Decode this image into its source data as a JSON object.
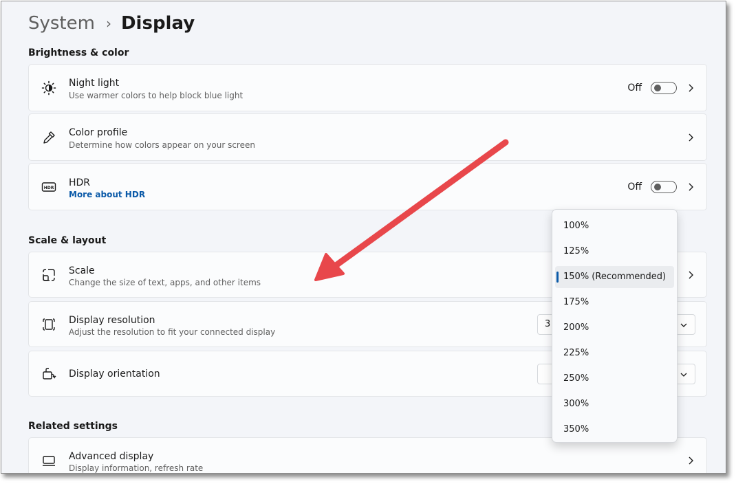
{
  "breadcrumb": {
    "parent": "System",
    "separator": "›",
    "current": "Display"
  },
  "sections": {
    "brightness": "Brightness & color",
    "scale_layout": "Scale & layout",
    "related": "Related settings"
  },
  "cards": {
    "night_light": {
      "title": "Night light",
      "subtitle": "Use warmer colors to help block blue light",
      "state": "Off",
      "icon": "brightness-icon"
    },
    "color_profile": {
      "title": "Color profile",
      "subtitle": "Determine how colors appear on your screen",
      "icon": "eyedropper-icon"
    },
    "hdr": {
      "title": "HDR",
      "link": "More about HDR",
      "state": "Off",
      "icon": "hdr-icon"
    },
    "scale": {
      "title": "Scale",
      "subtitle": "Change the size of text, apps, and other items",
      "icon": "scale-icon"
    },
    "resolution": {
      "title": "Display resolution",
      "subtitle": "Adjust the resolution to fit your connected display",
      "value": "3",
      "icon": "resolution-icon"
    },
    "orientation": {
      "title": "Display orientation",
      "icon": "orientation-icon"
    },
    "advanced": {
      "title": "Advanced display",
      "subtitle": "Display information, refresh rate",
      "icon": "monitor-icon"
    }
  },
  "scale_dropdown": {
    "options": [
      "100%",
      "125%",
      "150% (Recommended)",
      "175%",
      "200%",
      "225%",
      "250%",
      "300%",
      "350%"
    ],
    "selected": "150% (Recommended)"
  },
  "colors": {
    "accent": "#0b5aa8",
    "annotation_arrow": "#e8474b",
    "background": "#f3f5f9"
  }
}
